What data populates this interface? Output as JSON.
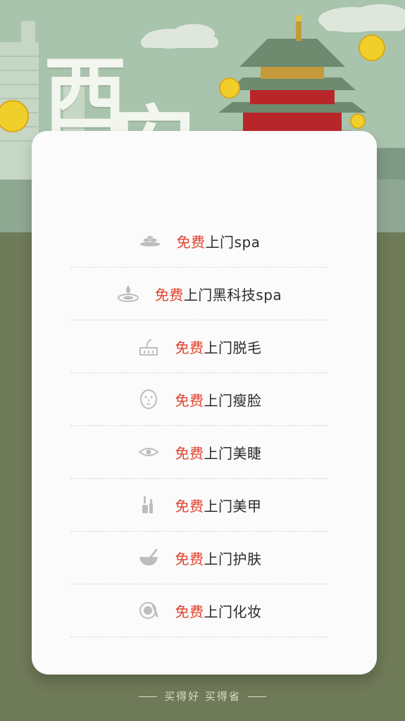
{
  "hero": {
    "char1": "西",
    "char2": "安"
  },
  "services": [
    {
      "highlight": "免费",
      "text": "上门spa",
      "icon": "spa-stones-icon"
    },
    {
      "highlight": "免费",
      "text": "上门黑科技spa",
      "icon": "water-drop-icon"
    },
    {
      "highlight": "免费",
      "text": "上门脱毛",
      "icon": "hair-removal-icon"
    },
    {
      "highlight": "免费",
      "text": "上门瘦脸",
      "icon": "face-mask-icon"
    },
    {
      "highlight": "免费",
      "text": "上门美睫",
      "icon": "eye-icon"
    },
    {
      "highlight": "免费",
      "text": "上门美甲",
      "icon": "nail-polish-icon"
    },
    {
      "highlight": "免费",
      "text": "上门护肤",
      "icon": "skincare-bowl-icon"
    },
    {
      "highlight": "免费",
      "text": "上门化妆",
      "icon": "makeup-icon"
    }
  ],
  "footer": {
    "slogan": "买得好 买得省"
  },
  "colors": {
    "accent": "#e2412e",
    "background": "#6f7a58",
    "hero": "#a9c4ad",
    "card": "#fbfbfb"
  }
}
